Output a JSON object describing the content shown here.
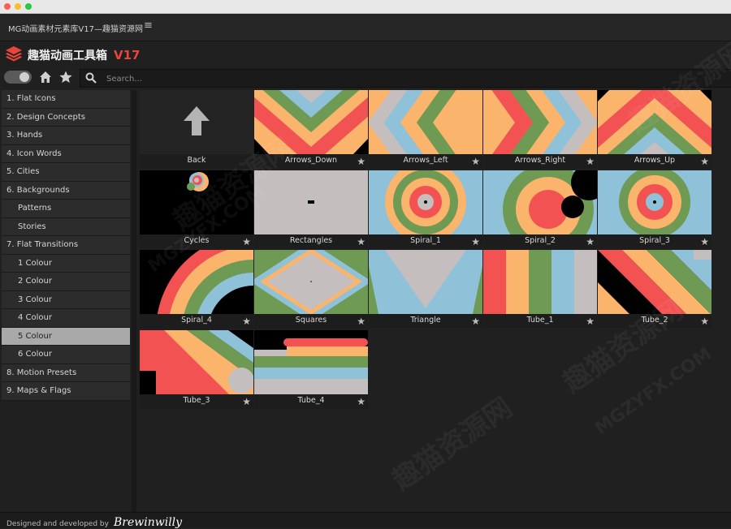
{
  "window": {
    "title": "MG动画素材元素库V17—趣猫资源网"
  },
  "brand": {
    "name": "趣猫动画工具箱",
    "version": "V17"
  },
  "search": {
    "placeholder": "Search..."
  },
  "sidebar": {
    "items": [
      {
        "label": "1. Flat Icons",
        "sub": false,
        "active": false
      },
      {
        "label": "2. Design Concepts",
        "sub": false,
        "active": false
      },
      {
        "label": "3. Hands",
        "sub": false,
        "active": false
      },
      {
        "label": "4. Icon Words",
        "sub": false,
        "active": false
      },
      {
        "label": "5. Cities",
        "sub": false,
        "active": false
      },
      {
        "label": "6. Backgrounds",
        "sub": false,
        "active": false
      },
      {
        "label": "Patterns",
        "sub": true,
        "active": false
      },
      {
        "label": "Stories",
        "sub": true,
        "active": false
      },
      {
        "label": "7. Flat Transitions",
        "sub": false,
        "active": false
      },
      {
        "label": "1 Colour",
        "sub": true,
        "active": false
      },
      {
        "label": "2 Colour",
        "sub": true,
        "active": false
      },
      {
        "label": "3 Colour",
        "sub": true,
        "active": false
      },
      {
        "label": "4 Colour",
        "sub": true,
        "active": false
      },
      {
        "label": "5 Colour",
        "sub": true,
        "active": true
      },
      {
        "label": "6 Colour",
        "sub": true,
        "active": false
      },
      {
        "label": "8. Motion Presets",
        "sub": false,
        "active": false
      },
      {
        "label": "9. Maps & Flags",
        "sub": false,
        "active": false
      }
    ]
  },
  "grid": {
    "items": [
      {
        "label": "Back",
        "kind": "back",
        "star": false
      },
      {
        "label": "Arrows_Down",
        "kind": "arrows_down",
        "star": true
      },
      {
        "label": "Arrows_Left",
        "kind": "arrows_left",
        "star": true
      },
      {
        "label": "Arrows_Right",
        "kind": "arrows_right",
        "star": true
      },
      {
        "label": "Arrows_Up",
        "kind": "arrows_up",
        "star": true
      },
      {
        "label": "Cycles",
        "kind": "cycles",
        "star": true
      },
      {
        "label": "Rectangles",
        "kind": "rectangles",
        "star": true
      },
      {
        "label": "Spiral_1",
        "kind": "spiral1",
        "star": true
      },
      {
        "label": "Spiral_2",
        "kind": "spiral2",
        "star": true
      },
      {
        "label": "Spiral_3",
        "kind": "spiral3",
        "star": true
      },
      {
        "label": "Spiral_4",
        "kind": "spiral4",
        "star": true
      },
      {
        "label": "Squares",
        "kind": "squares",
        "star": true
      },
      {
        "label": "Triangle",
        "kind": "triangle",
        "star": true
      },
      {
        "label": "Tube_1",
        "kind": "tube1",
        "star": true
      },
      {
        "label": "Tube_2",
        "kind": "tube2",
        "star": true
      },
      {
        "label": "Tube_3",
        "kind": "tube3",
        "star": true
      },
      {
        "label": "Tube_4",
        "kind": "tube4",
        "star": true
      }
    ]
  },
  "footer": {
    "credit": "Designed and developed by",
    "signature": "Brewinwilly"
  },
  "watermark": {
    "text": "趣猫资源网",
    "latin": "MGZYFX.COM"
  },
  "colors": {
    "red": "#f25352",
    "orange": "#fbb46c",
    "green": "#6e9a54",
    "blue": "#8fc1d8",
    "grey": "#c4bebe",
    "accent": "#e8463c"
  }
}
